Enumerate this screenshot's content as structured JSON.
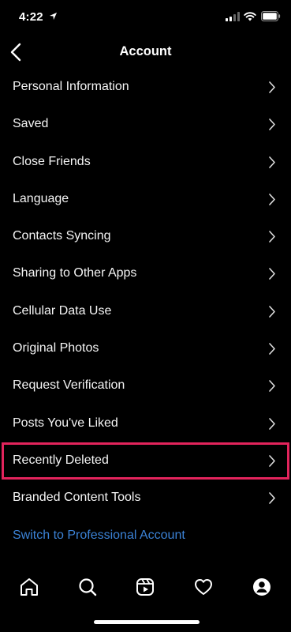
{
  "status_bar": {
    "time": "4:22"
  },
  "header": {
    "title": "Account"
  },
  "menu": {
    "items": [
      {
        "label": "Personal Information"
      },
      {
        "label": "Saved"
      },
      {
        "label": "Close Friends"
      },
      {
        "label": "Language"
      },
      {
        "label": "Contacts Syncing"
      },
      {
        "label": "Sharing to Other Apps"
      },
      {
        "label": "Cellular Data Use"
      },
      {
        "label": "Original Photos"
      },
      {
        "label": "Request Verification"
      },
      {
        "label": "Posts You've Liked"
      },
      {
        "label": "Recently Deleted"
      },
      {
        "label": "Branded Content Tools"
      }
    ],
    "professional_link": "Switch to Professional Account"
  },
  "colors": {
    "highlight_border": "#e2245c",
    "link": "#3b82d6",
    "background": "#000000"
  },
  "tab_bar": {
    "icons": [
      "home-icon",
      "search-icon",
      "reels-icon",
      "heart-icon",
      "profile-icon"
    ]
  }
}
